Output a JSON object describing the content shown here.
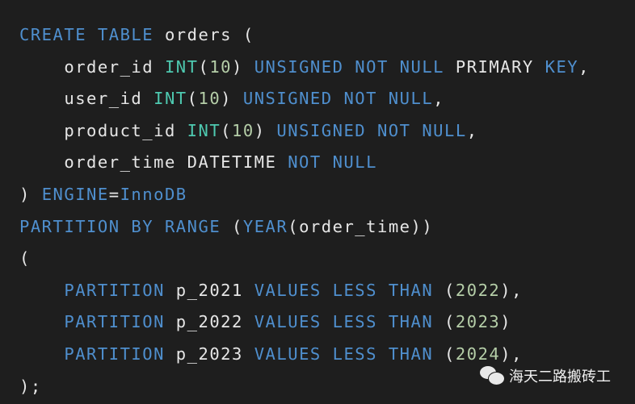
{
  "colors": {
    "background": "#1e1e1e",
    "keyword": "#4f8fce",
    "type": "#4ec9b0",
    "number": "#b5cea8",
    "plain": "#e6e6e6"
  },
  "code": {
    "lines": [
      [
        {
          "t": "CREATE TABLE",
          "c": "kw"
        },
        {
          "t": " orders (",
          "c": "pl"
        }
      ],
      [
        {
          "t": "    order_id ",
          "c": "pl"
        },
        {
          "t": "INT",
          "c": "ty"
        },
        {
          "t": "(",
          "c": "pl"
        },
        {
          "t": "10",
          "c": "num"
        },
        {
          "t": ") ",
          "c": "pl"
        },
        {
          "t": "UNSIGNED NOT NULL",
          "c": "kw"
        },
        {
          "t": " PRIMARY ",
          "c": "pl"
        },
        {
          "t": "KEY",
          "c": "kw"
        },
        {
          "t": ",",
          "c": "pl"
        }
      ],
      [
        {
          "t": "    user_id ",
          "c": "pl"
        },
        {
          "t": "INT",
          "c": "ty"
        },
        {
          "t": "(",
          "c": "pl"
        },
        {
          "t": "10",
          "c": "num"
        },
        {
          "t": ") ",
          "c": "pl"
        },
        {
          "t": "UNSIGNED NOT NULL",
          "c": "kw"
        },
        {
          "t": ",",
          "c": "pl"
        }
      ],
      [
        {
          "t": "    product_id ",
          "c": "pl"
        },
        {
          "t": "INT",
          "c": "ty"
        },
        {
          "t": "(",
          "c": "pl"
        },
        {
          "t": "10",
          "c": "num"
        },
        {
          "t": ") ",
          "c": "pl"
        },
        {
          "t": "UNSIGNED NOT NULL",
          "c": "kw"
        },
        {
          "t": ",",
          "c": "pl"
        }
      ],
      [
        {
          "t": "    order_time DATETIME ",
          "c": "pl"
        },
        {
          "t": "NOT NULL",
          "c": "kw"
        }
      ],
      [
        {
          "t": ") ",
          "c": "pl"
        },
        {
          "t": "ENGINE",
          "c": "kw"
        },
        {
          "t": "=",
          "c": "pl"
        },
        {
          "t": "InnoDB",
          "c": "kw"
        }
      ],
      [
        {
          "t": "PARTITION BY RANGE",
          "c": "kw"
        },
        {
          "t": " (",
          "c": "pl"
        },
        {
          "t": "YEAR",
          "c": "kw"
        },
        {
          "t": "(order_time))",
          "c": "pl"
        }
      ],
      [
        {
          "t": "(",
          "c": "pl"
        }
      ],
      [
        {
          "t": "    ",
          "c": "pl"
        },
        {
          "t": "PARTITION",
          "c": "kw"
        },
        {
          "t": " p_2021 ",
          "c": "pl"
        },
        {
          "t": "VALUES LESS THAN",
          "c": "kw"
        },
        {
          "t": " (",
          "c": "pl"
        },
        {
          "t": "2022",
          "c": "num"
        },
        {
          "t": "),",
          "c": "pl"
        }
      ],
      [
        {
          "t": "    ",
          "c": "pl"
        },
        {
          "t": "PARTITION",
          "c": "kw"
        },
        {
          "t": " p_2022 ",
          "c": "pl"
        },
        {
          "t": "VALUES LESS THAN",
          "c": "kw"
        },
        {
          "t": " (",
          "c": "pl"
        },
        {
          "t": "2023",
          "c": "num"
        },
        {
          "t": ")",
          "c": "pl"
        }
      ],
      [
        {
          "t": "    ",
          "c": "pl"
        },
        {
          "t": "PARTITION",
          "c": "kw"
        },
        {
          "t": " p_2023 ",
          "c": "pl"
        },
        {
          "t": "VALUES LESS THAN",
          "c": "kw"
        },
        {
          "t": " (",
          "c": "pl"
        },
        {
          "t": "2024",
          "c": "num"
        },
        {
          "t": "),",
          "c": "pl"
        }
      ],
      [
        {
          "t": ");",
          "c": "pl"
        }
      ]
    ]
  },
  "watermark": {
    "icon": "wechat-icon",
    "text": "海天二路搬砖工"
  }
}
